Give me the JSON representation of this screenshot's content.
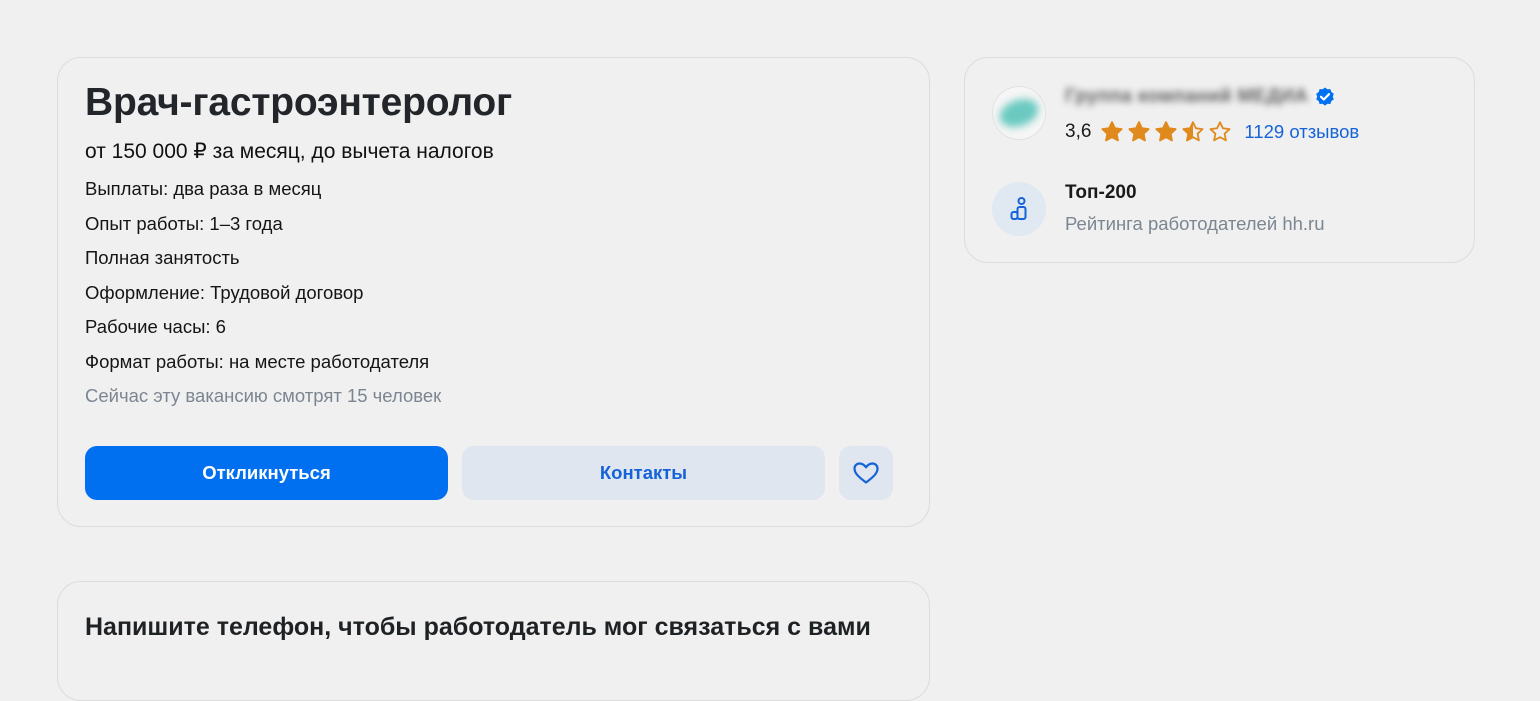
{
  "vacancy": {
    "title": "Врач-гастроэнтеролог",
    "salary": "от 150 000 ₽ за месяц, до вычета налогов",
    "details": [
      "Выплаты: два раза в месяц",
      "Опыт работы: 1–3 года",
      "Полная занятость",
      "Оформление: Трудовой договор",
      "Рабочие часы: 6",
      "Формат работы: на месте работодателя"
    ],
    "watchers": "Сейчас эту вакансию смотрят 15 человек",
    "actions": {
      "respond_label": "Откликнуться",
      "contacts_label": "Контакты",
      "favorite_icon": "heart-icon"
    }
  },
  "employer": {
    "name": "Группа компаний МЕДИА",
    "verified_icon": "verified-badge-icon",
    "rating_value": "3,6",
    "rating_stars": 3.5,
    "rating_max": 5,
    "reviews_label": "1129 отзывов",
    "badge_title": "Топ-200",
    "badge_subtitle": "Рейтинга работодателей hh.ru",
    "badge_icon": "rating-podium-icon"
  },
  "phone_prompt": {
    "title": "Напишите телефон, чтобы работодатель мог связаться с вами"
  },
  "colors": {
    "background": "#f0f0f0",
    "primary": "#0070f0",
    "secondary_bg": "#e0e6ef",
    "link": "#1563d8",
    "star": "#e08a1e",
    "muted": "#7c8691"
  }
}
